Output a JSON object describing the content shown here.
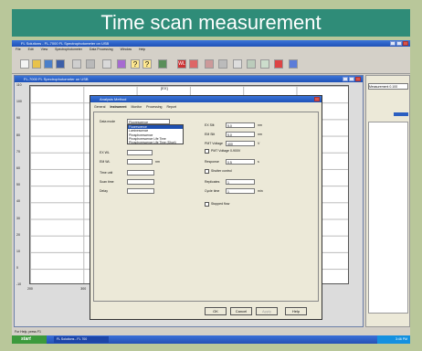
{
  "banner": {
    "title": "Time scan measurement"
  },
  "app": {
    "title": "FL Solutions - FL-7000 FL Spectrophotometer on USB",
    "menu": [
      "File",
      "Edit",
      "View",
      "Spectrophotometer",
      "Data Processing",
      "Window",
      "Help"
    ]
  },
  "spectrum": {
    "title": "FL-7000 FL Spectrophotometer on USB",
    "label": "[EX]",
    "y_ticks": [
      "110",
      "100",
      "90",
      "80",
      "70",
      "60",
      "50",
      "40",
      "30",
      "20",
      "10",
      "0",
      "-10"
    ],
    "x_ticks": [
      "200",
      "300",
      "400",
      "500",
      "600",
      "700"
    ]
  },
  "dialog": {
    "title": "Analysis Method",
    "tabs": [
      "General",
      "Instrument",
      "Monitor",
      "Processing",
      "Report"
    ],
    "data_mode_label": "Data mode",
    "data_mode_value": "Fluorescence",
    "dropdown_options": [
      "Fluorescence",
      "Luminescence",
      "Phosphorescence",
      "Phosphorescence Life Time",
      "Phosphorescence Life Time (Short)"
    ],
    "ex_wl_label": "EX WL",
    "em_wl_label": "EM WL",
    "em_wl_unit": "nm",
    "time_unit_label": "Time unit",
    "scan_time_label": "Scan time",
    "delay_label": "Delay",
    "ex_slit_label": "EX Slit",
    "ex_slit_value": "5.0",
    "nm": "nm",
    "em_slit_label": "EM Slit",
    "em_slit_value": "5.0",
    "pmt_label": "PMT Voltage",
    "pmt_value": "400",
    "pmt_unit": "V",
    "pmt_check": "PMT Voltage 0-900V",
    "response_label": "Response",
    "response_value": "0.5",
    "response_unit": "s",
    "shutter_label": "Shutter control",
    "replicates_label": "Replicates",
    "replicates_value": "1",
    "cycle_label": "Cycle time",
    "cycle_value": "1",
    "cycle_unit": "min",
    "stopped_flow_label": "Stopped flow",
    "ok": "OK",
    "cancel": "Cancel",
    "apply": "Apply",
    "help": "Help"
  },
  "side": {
    "measure": "Measurement",
    "value": "0.100"
  },
  "status": {
    "text": "For Help, press F1"
  },
  "taskbar": {
    "start": "start",
    "task": "FL Solutions - FL 700",
    "clock": "3:46 PM"
  }
}
